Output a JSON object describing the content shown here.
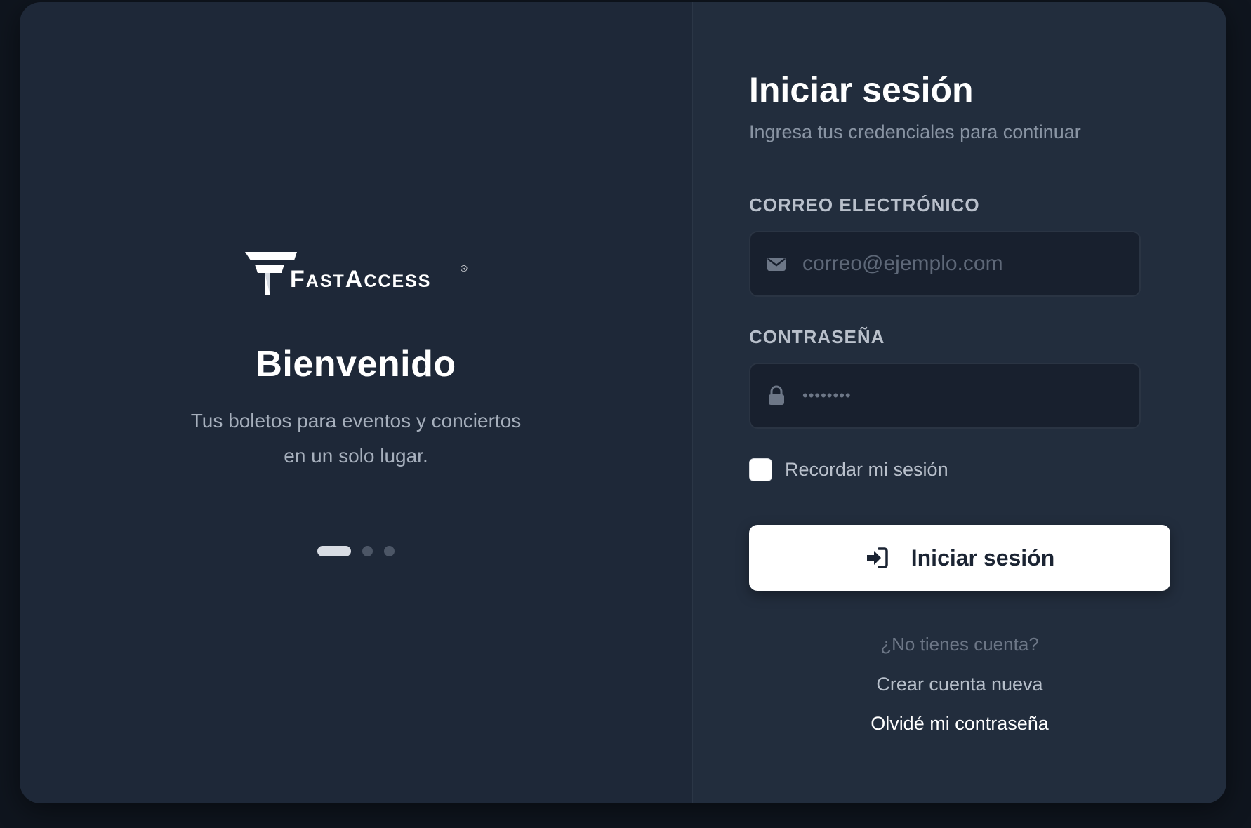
{
  "brand": {
    "logo_text": "FastAccess",
    "logo_mark": "®"
  },
  "welcome": {
    "title": "Bienvenido",
    "tagline_line1": "Tus boletos para eventos y conciertos",
    "tagline_line2": "en un solo lugar."
  },
  "carousel": {
    "total_slides": 3,
    "active_slide": 1
  },
  "login": {
    "title": "Iniciar sesión",
    "subtitle": "Ingresa tus credenciales para continuar",
    "email_label": "CORREO ELECTRÓNICO",
    "email_placeholder": "correo@ejemplo.com",
    "email_icon": "envelope-icon",
    "password_label": "CONTRASEÑA",
    "password_value": "••••••••",
    "password_icon": "lock-icon",
    "remember_label": "Recordar mi sesión",
    "remember_checked": false,
    "submit_label": "Iniciar sesión",
    "submit_icon": "sign-in-icon",
    "no_account_text": "¿No tienes cuenta?",
    "create_account_link": "Crear cuenta nueva",
    "forgot_password_link": "Olvidé mi contraseña"
  },
  "colors": {
    "background": "#0f151e",
    "left_panel": "#1e2838",
    "right_panel": "#222d3d",
    "input_bg": "#18202e",
    "button_bg": "#ffffff",
    "button_text": "#1b2433"
  }
}
